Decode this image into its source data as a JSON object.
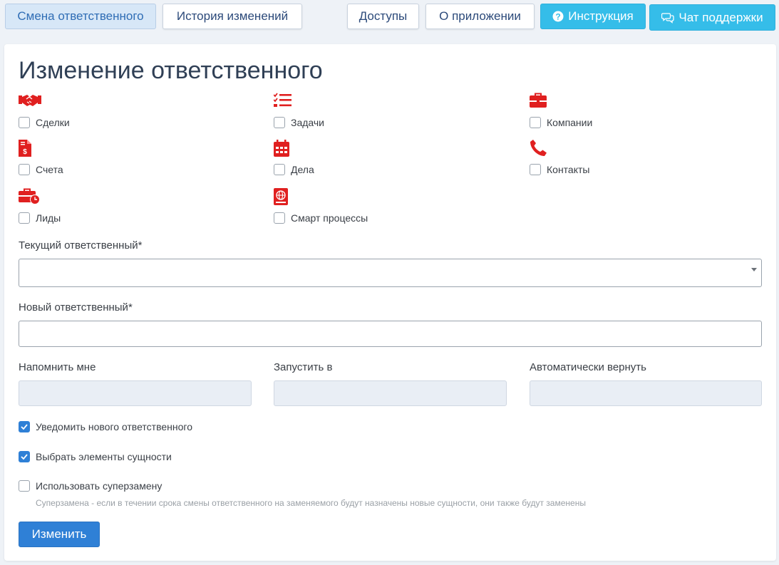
{
  "nav": {
    "tab_change": "Смена ответственного",
    "tab_history": "История изменений",
    "access": "Доступы",
    "about": "О приложении",
    "instruction": "Инструкция",
    "support": "Чат поддержки"
  },
  "page": {
    "title": "Изменение ответственного"
  },
  "entities": [
    {
      "label": "Сделки",
      "icon": "handshake-icon",
      "checked": false
    },
    {
      "label": "Задачи",
      "icon": "task-list-icon",
      "checked": false
    },
    {
      "label": "Компании",
      "icon": "briefcase-icon",
      "checked": false
    },
    {
      "label": "Счета",
      "icon": "invoice-icon",
      "checked": false
    },
    {
      "label": "Дела",
      "icon": "calendar-icon",
      "checked": false
    },
    {
      "label": "Контакты",
      "icon": "phone-icon",
      "checked": false
    },
    {
      "label": "Лиды",
      "icon": "briefcase-clock-icon",
      "checked": false
    },
    {
      "label": "Смарт процессы",
      "icon": "globe-book-icon",
      "checked": false
    }
  ],
  "form": {
    "current_label": "Текущий ответственный*",
    "current_value": "",
    "new_label": "Новый ответственный*",
    "new_value": "",
    "remind_label": "Напомнить мне",
    "start_label": "Запустить в",
    "return_label": "Автоматически вернуть",
    "notify_label": "Уведомить нового ответственного",
    "notify_checked": true,
    "select_elements_label": "Выбрать элементы сущности",
    "select_elements_checked": true,
    "super_label": "Использовать суперзамену",
    "super_checked": false,
    "super_hint": "Суперзамена - если в течении срока смены ответственного на заменяемого будут назначены новые сущности, они также будут заменены",
    "submit": "Изменить"
  },
  "colors": {
    "icon_red": "#e02020",
    "primary": "#2f80d6",
    "cyan": "#35bde9"
  }
}
